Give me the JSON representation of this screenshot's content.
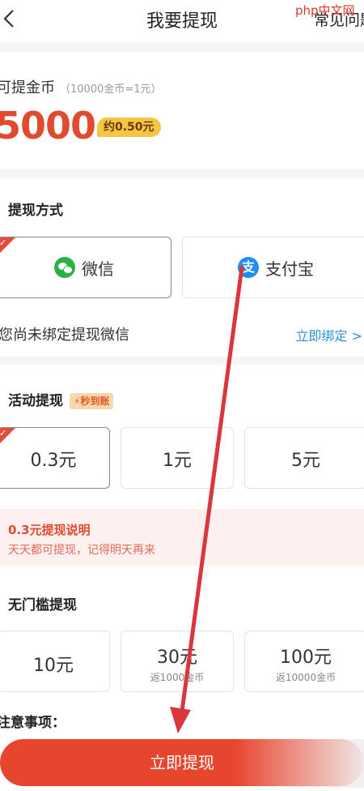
{
  "header": {
    "title": "我要提现",
    "help_label": "常见问题",
    "watermark_text": "php中文网"
  },
  "balance": {
    "label": "可提金币",
    "rate": "（10000金币=1元）",
    "value": "5000",
    "approx": "约0.50元"
  },
  "method": {
    "section_title": "提现方式",
    "options": [
      {
        "label": "微信",
        "icon": "wechat-icon",
        "selected": true
      },
      {
        "label": "支付宝",
        "icon": "alipay-icon",
        "selected": false
      }
    ],
    "bind_text": "您尚未绑定提现微信",
    "bind_link": "立即绑定 >"
  },
  "activity": {
    "section_title": "活动提现",
    "badge": "秒到账",
    "amounts": [
      "0.3元",
      "1元",
      "5元"
    ],
    "selected_index": 0,
    "note_title": "0.3元提现说明",
    "note_text": "天天都可提现，记得明天再来"
  },
  "threshold": {
    "section_title": "无门槛提现",
    "amounts": [
      {
        "value": "10元",
        "sub": ""
      },
      {
        "value": "30元",
        "sub": "返1000金币"
      },
      {
        "value": "100元",
        "sub": "返10000金币"
      }
    ]
  },
  "footer": {
    "caution": "注意事项：",
    "cta_label": "立即提现"
  },
  "colors": {
    "accent": "#e8452f",
    "link": "#2d8fd8",
    "badge_yellow": "#f7c544",
    "arrow": "#d9363e"
  }
}
